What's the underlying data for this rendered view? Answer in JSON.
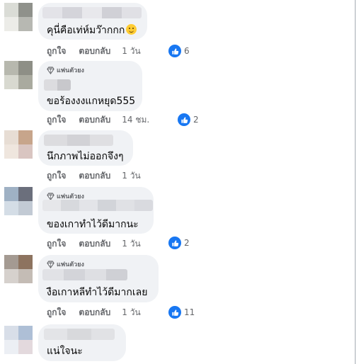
{
  "comments": [
    {
      "text": "คุนี่คือเท่ห์มว๊ากกก",
      "has_emoji": true,
      "has_badge": false,
      "like_label": "ถูกใจ",
      "reply_label": "ตอบกลับ",
      "time": "1 วัน",
      "reaction_count": "6"
    },
    {
      "badge_label": "แฟนตัวยง",
      "text": "ขอร้องงงแกหยุด555",
      "has_badge": true,
      "like_label": "ถูกใจ",
      "reply_label": "ตอบกลับ",
      "time": "14 ชม.",
      "reaction_count": "2"
    },
    {
      "text": "นึกภาพไม่ออกจึงๆ",
      "has_badge": false,
      "like_label": "ถูกใจ",
      "reply_label": "ตอบกลับ",
      "time": "1 วัน",
      "reaction_count": ""
    },
    {
      "badge_label": "แฟนตัวยง",
      "text": "ของเกาทำไว้ดีมากนะ",
      "has_badge": true,
      "like_label": "ถูกใจ",
      "reply_label": "ตอบกลับ",
      "time": "1 วัน",
      "reaction_count": "2"
    },
    {
      "badge_label": "แฟนตัวยง",
      "text": "งือเกาหลีทำไว้ดีมากเลย",
      "has_badge": true,
      "like_label": "ถูกใจ",
      "reply_label": "ตอบกลับ",
      "time": "1 วัน",
      "reaction_count": "11"
    },
    {
      "text": "แน่ใจนะ",
      "has_badge": false
    }
  ],
  "colors": {
    "bubble": "#f0f2f5",
    "meta_text": "#65676b",
    "like_blue": "#1877f2"
  },
  "icons": {
    "reaction": "thumbs-up-icon",
    "badge": "diamond-icon",
    "emoji": "smiling-face-emoji"
  }
}
